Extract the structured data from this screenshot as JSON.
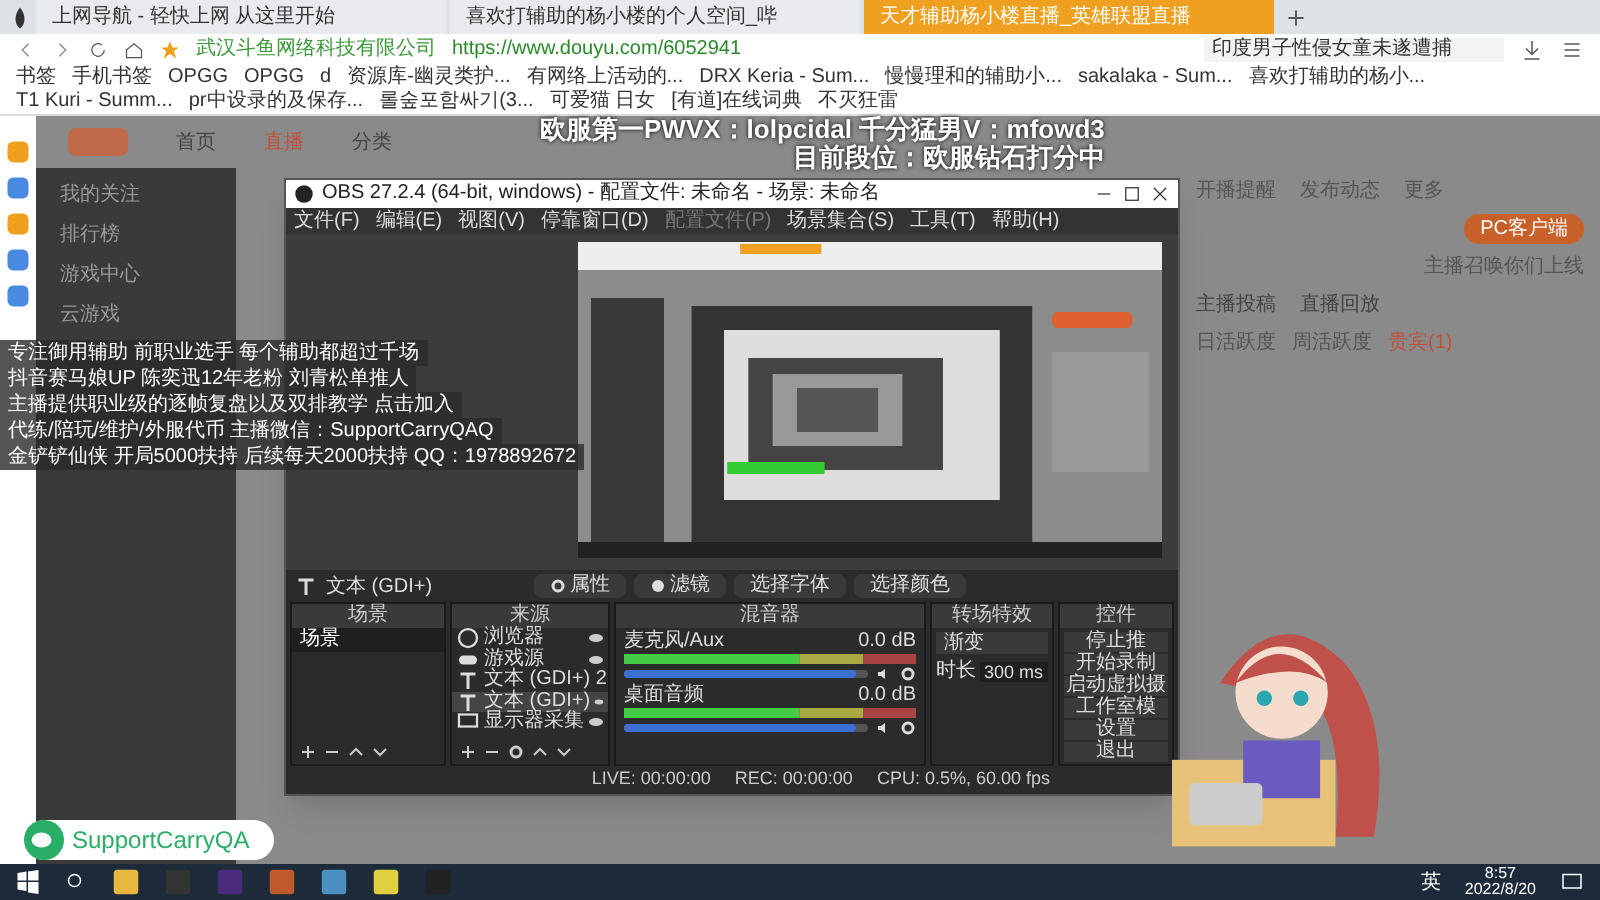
{
  "browser": {
    "tabs": [
      {
        "label": "上网导航 - 轻快上网 从这里开始",
        "selected": false
      },
      {
        "label": "喜欢打辅助的杨小楼的个人空间_哔",
        "selected": false
      },
      {
        "label": "天才辅助杨小楼直播_英雄联盟直播",
        "selected": true
      }
    ],
    "site_name": "武汉斗鱼网络科技有限公司",
    "url": "https://www.douyu.com/6052941",
    "search_value": "印度男子性侵女童未遂遭捕",
    "bookmarks": [
      "书签",
      "手机书签",
      "OPGG",
      "OPGG",
      "d",
      "资源库-幽灵类护...",
      "有网络上活动的...",
      "DRX Keria - Sum...",
      "慢慢理和的辅助小...",
      "sakalaka - Sum...",
      "喜欢打辅助的杨小...",
      "T1 Kuri - Summ...",
      "pr中设录的及保存...",
      "롤숲포함싸기(3...",
      "可爱猫 日女",
      "[有道]在线词典",
      "不灭狂雷"
    ]
  },
  "stream_page": {
    "nav": [
      {
        "label": "首页",
        "selected": false
      },
      {
        "label": "直播",
        "selected": true
      },
      {
        "label": "分类",
        "selected": false
      }
    ],
    "sidebar": [
      "我的关注",
      "排行榜",
      "游戏中心",
      "云游戏"
    ],
    "actions": [
      "开播提醒",
      "发布动态",
      "更多"
    ],
    "client_button": "PC客户端",
    "client_note": "主播召唤你们上线",
    "panel_links": [
      "主播投稿",
      "直播回放"
    ],
    "panel_tabs": [
      {
        "label": "日活跃度",
        "selected": false
      },
      {
        "label": "周活跃度",
        "selected": false
      },
      {
        "label": "贵宾(1)",
        "selected": true
      }
    ]
  },
  "overlay": {
    "top_lines": [
      "欧服第一PWVX：lolpcidal 千分猛男V：mfowd3",
      "目前段位：欧服钻石打分中"
    ],
    "left_lines": [
      "专注御用辅助 前职业选手 每个辅助都超过千场",
      "抖音赛马娘UP 陈奕迅12年老粉 刘青松单推人",
      "主播提供职业级的逐帧复盘以及双排教学 点击加入",
      "代练/陪玩/维护/外服代币 主播微信：SupportCarryQAQ",
      "金铲铲仙侠 开局5000扶持 后续每天2000扶持 QQ：1978892672"
    ],
    "wechat_id": "SupportCarryQA"
  },
  "obs": {
    "title": "OBS 27.2.4 (64-bit, windows) - 配置文件: 未命名 - 场景: 未命名",
    "menu": [
      {
        "label": "文件(F)",
        "disabled": false
      },
      {
        "label": "编辑(E)",
        "disabled": false
      },
      {
        "label": "视图(V)",
        "disabled": false
      },
      {
        "label": "停靠窗口(D)",
        "disabled": false
      },
      {
        "label": "配置文件(P)",
        "disabled": true
      },
      {
        "label": "场景集合(S)",
        "disabled": false
      },
      {
        "label": "工具(T)",
        "disabled": false
      },
      {
        "label": "帮助(H)",
        "disabled": false
      }
    ],
    "selected_source": "文本 (GDI+)",
    "toolbar_buttons": [
      {
        "kind": "properties",
        "label": "属性"
      },
      {
        "kind": "filters",
        "label": "滤镜"
      },
      {
        "kind": "plain",
        "label": "选择字体"
      },
      {
        "kind": "plain",
        "label": "选择颜色"
      }
    ],
    "scenes": {
      "title": "场景",
      "items": [
        {
          "label": "场景",
          "selected": true
        }
      ]
    },
    "sources": {
      "title": "来源",
      "items": [
        {
          "kind": "browser",
          "label": "浏览器",
          "selected": false
        },
        {
          "kind": "game",
          "label": "游戏源",
          "selected": false
        },
        {
          "kind": "text",
          "label": "文本 (GDI+) 2",
          "selected": false
        },
        {
          "kind": "text",
          "label": "文本 (GDI+)",
          "selected": true
        },
        {
          "kind": "display",
          "label": "显示器采集",
          "selected": false
        }
      ]
    },
    "mixer": {
      "title": "混音器",
      "channels": [
        {
          "name": "麦克风/Aux",
          "reading": "0.0 dB",
          "level": 0.95
        },
        {
          "name": "桌面音频",
          "reading": "0.0 dB",
          "level": 0.95
        }
      ]
    },
    "transition": {
      "title": "转场特效",
      "value": "渐变",
      "duration_label": "时长",
      "duration": "300 ms"
    },
    "controls": {
      "title": "控件",
      "buttons": [
        "停止推",
        "开始录制",
        "启动虚拟摄",
        "工作室模",
        "设置",
        "退出"
      ]
    },
    "status": {
      "live": "LIVE: 00:00:00",
      "rec": "REC: 00:00:00",
      "cpu": "CPU: 0.5%, 60.00 fps"
    }
  },
  "taskbar": {
    "ime": "英",
    "time": "8:57",
    "date": "2022/8/20"
  }
}
